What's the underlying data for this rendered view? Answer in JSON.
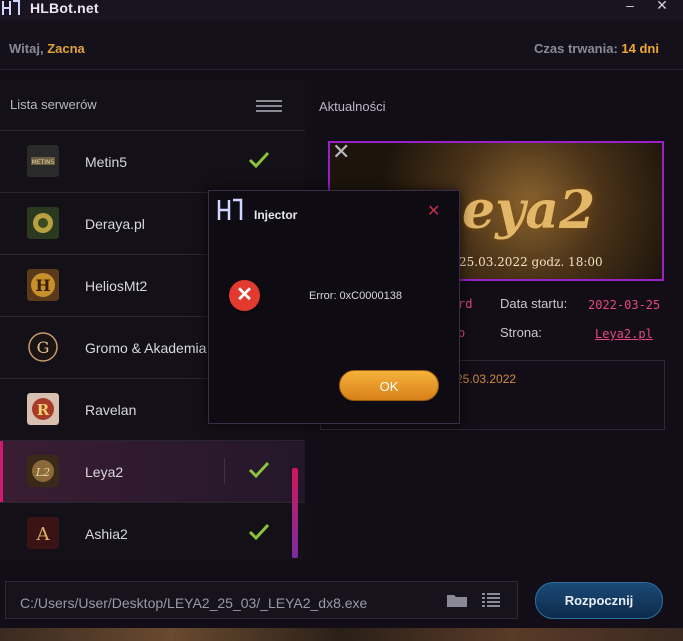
{
  "app": {
    "title": "HLBot.net"
  },
  "header": {
    "welcome_prefix": "Witaj,",
    "welcome_name": "Zacna",
    "duration_label": "Czas trwania:",
    "duration_value": "14 dni"
  },
  "servers": {
    "heading": "Lista serwerów",
    "items": [
      {
        "name": "Metin5",
        "checked": true
      },
      {
        "name": "Deraya.pl",
        "checked": false
      },
      {
        "name": "HeliosMt2",
        "checked": false
      },
      {
        "name": "Gromo & Akademia",
        "checked": false
      },
      {
        "name": "Ravelan",
        "checked": false
      },
      {
        "name": "Leya2",
        "checked": true,
        "active": true
      },
      {
        "name": "Ashia2",
        "checked": true
      }
    ]
  },
  "news": {
    "heading": "Aktualności",
    "banner_logo": "eya2",
    "banner_date": "25.03.2022 godz. 18:00",
    "start_label": "Data startu:",
    "start_value": "2022-03-25",
    "site_label": "Strona:",
    "site_value": "Leya2.pl",
    "partial_1": "rd",
    "partial_2": "o",
    "news_date": "25.03.2022"
  },
  "dialog": {
    "title": "Injector",
    "message": "Error: 0xC0000138",
    "ok_label": "OK"
  },
  "footer": {
    "path": "C:/Users/User/Desktop/LEYA2_25_03/_LEYA2_dx8.exe",
    "start_label": "Rozpocznij"
  },
  "colors": {
    "accent": "#e0a33a",
    "active": "#d01a6f",
    "link": "#e44a7a",
    "ok": "#f0a830"
  }
}
